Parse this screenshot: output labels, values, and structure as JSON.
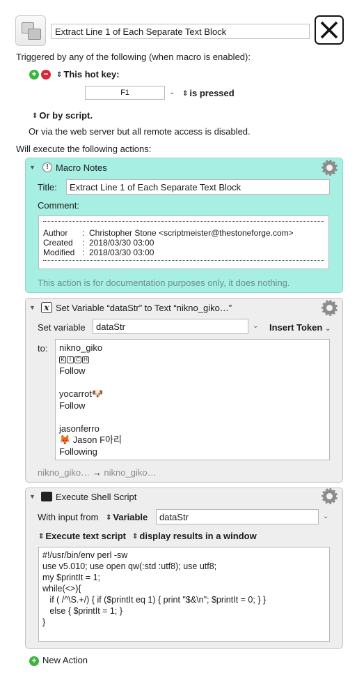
{
  "header": {
    "macro_name": "Extract Line 1 of Each Separate Text Block"
  },
  "triggers": {
    "intro": "Triggered by any of the following (when macro is enabled):",
    "hotkey_label": "This hot key:",
    "hotkey_value": "F1",
    "is_pressed": "is pressed",
    "or_by_script": "Or by script.",
    "web_server": "Or via the web server but all remote access is disabled.",
    "will_execute": "Will execute the following actions:"
  },
  "notes_action": {
    "header": "Macro Notes",
    "title_label": "Title:",
    "title_value": "Extract Line 1 of Each Separate Text Block",
    "comment_label": "Comment:",
    "author_label": "Author",
    "author_value": "Christopher Stone <scriptmeister@thestoneforge.com>",
    "created_label": "Created",
    "created_value": "2018/03/30 03:00",
    "modified_label": "Modified",
    "modified_value": "2018/03/30 03:00",
    "colon": ":",
    "footer": "This action is for documentation purposes only, it does nothing."
  },
  "setvar_action": {
    "header": "Set Variable “dataStr” to Text “nikno_giko…”",
    "set_variable_label": "Set variable",
    "variable_name": "dataStr",
    "insert_token": "Insert Token",
    "to_label": "to:",
    "lines": {
      "l1": "nikno_giko",
      "l3": "Follow",
      "l5": "yocarrot🐶",
      "l6": "Follow",
      "l8": "jasonferro",
      "l9": "🦊 Jason F아리",
      "l10": "Following"
    },
    "preview_from": "nikno_giko…",
    "preview_arrow": "→",
    "preview_to": "nikno_giko…"
  },
  "shell_action": {
    "header": "Execute Shell Script",
    "input_label": "With input from",
    "input_source": "Variable",
    "input_var": "dataStr",
    "mode": "Execute text script",
    "output": "display results in a window",
    "script": {
      "l1": "#!/usr/bin/env perl -sw",
      "l2": "use v5.010; use open qw(:std :utf8); use utf8;",
      "l3": "my $printIt = 1;",
      "l4": "while(<>){",
      "l5": "   if ( /^\\S.+/) { if ($printIt eq 1) { print \"$&\\n\"; $printIt = 0; } }",
      "l6": "   else { $printIt = 1; }",
      "l7": "}"
    }
  },
  "new_action": "New Action",
  "colors": {
    "notes_bg": "#a7efe3",
    "action_bg": "#eeeeee",
    "add_green": "#3db43d",
    "remove_red": "#d8283a"
  }
}
